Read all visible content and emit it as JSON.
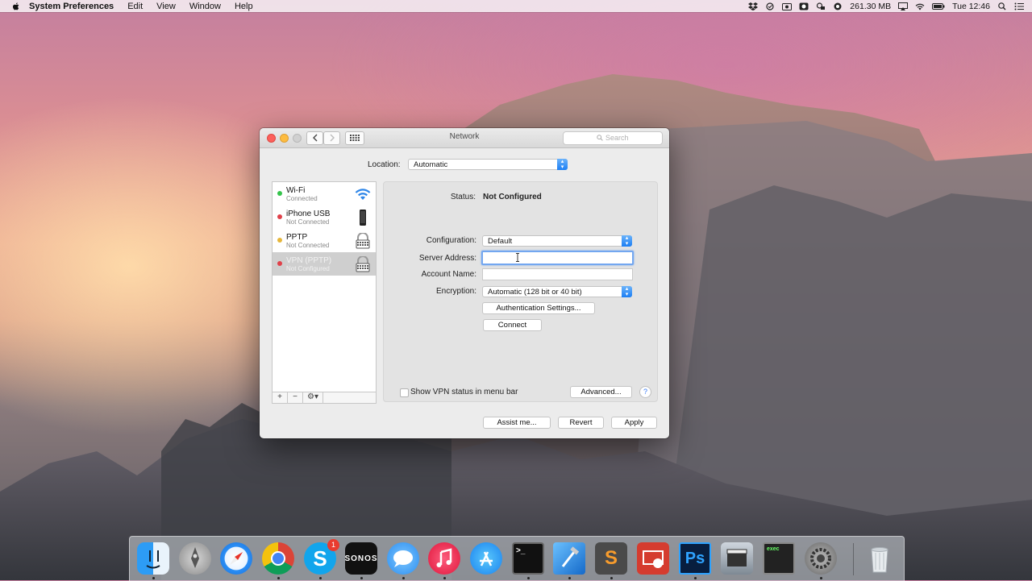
{
  "menubar": {
    "app_name": "System Preferences",
    "menus": [
      "Edit",
      "View",
      "Window",
      "Help"
    ],
    "memory": "261.30 MB",
    "clock": "Tue 12:46",
    "icons": [
      "dropbox-icon",
      "sync-icon",
      "camera-icon",
      "spotlight-cloud-icon",
      "keyboard-icon",
      "memory-icon",
      "airplay-icon",
      "wifi-icon",
      "battery-icon",
      "search-icon",
      "list-icon"
    ]
  },
  "window": {
    "title": "Network",
    "search_placeholder": "Search",
    "location_label": "Location:",
    "location_value": "Automatic",
    "services": [
      {
        "name": "Wi-Fi",
        "status": "Connected",
        "dot": "#35c44b",
        "icon": "wifi-icon"
      },
      {
        "name": "iPhone USB",
        "status": "Not Connected",
        "dot": "#e0414a",
        "icon": "iphone-icon"
      },
      {
        "name": "PPTP",
        "status": "Not Connected",
        "dot": "#e6b63a",
        "icon": "vpn-lock-icon"
      },
      {
        "name": "VPN (PPTP)",
        "status": "Not Configured",
        "dot": "#e0414a",
        "icon": "vpn-lock-icon"
      }
    ],
    "list_buttons": [
      "+",
      "−",
      "⚙▾"
    ],
    "detail": {
      "status_label": "Status:",
      "status_value": "Not Configured",
      "configuration_label": "Configuration:",
      "configuration_value": "Default",
      "server_label": "Server Address:",
      "server_value": "",
      "account_label": "Account Name:",
      "account_value": "",
      "encryption_label": "Encryption:",
      "encryption_value": "Automatic (128 bit or 40 bit)",
      "auth_button": "Authentication Settings...",
      "connect_button": "Connect",
      "show_vpn_label": "Show VPN status in menu bar",
      "advanced_button": "Advanced...",
      "help_label": "?"
    },
    "footer": {
      "assist_button": "Assist me...",
      "revert_button": "Revert",
      "apply_button": "Apply"
    }
  },
  "dock": {
    "apps": [
      "Finder",
      "Launchpad",
      "Safari",
      "Chrome",
      "Skype",
      "Sonos",
      "Messages",
      "iTunes",
      "App Store",
      "Terminal",
      "Xcode",
      "Sublime Text",
      "Remote Desktop",
      "Photoshop",
      "Final Cut",
      "Console",
      "System Preferences",
      "Trash"
    ],
    "skype_badge": "1",
    "sonos_label": "SONOS",
    "ps_label": "Ps",
    "sublime_label": "S"
  }
}
